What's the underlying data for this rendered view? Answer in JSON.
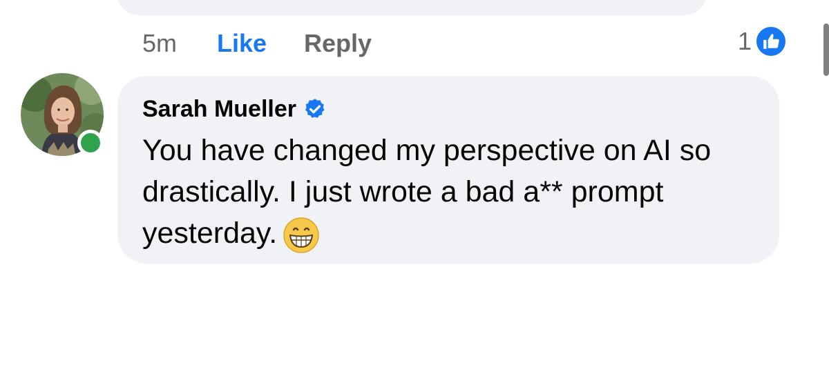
{
  "previous_comment": {
    "time": "5m",
    "like_label": "Like",
    "reply_label": "Reply",
    "reaction_count": "1",
    "reaction_icon": "like-icon"
  },
  "comment": {
    "author": "Sarah Mueller",
    "verified": true,
    "text": "You have changed my perspective on AI so drastically. I just wrote a bad a** prompt yesterday.",
    "emoji": "grinning-face-emoji",
    "online": true
  },
  "colors": {
    "like_blue": "#1877f2",
    "bubble_bg": "#f0f2f5",
    "secondary_text": "#65676b",
    "online_green": "#31a24c"
  }
}
